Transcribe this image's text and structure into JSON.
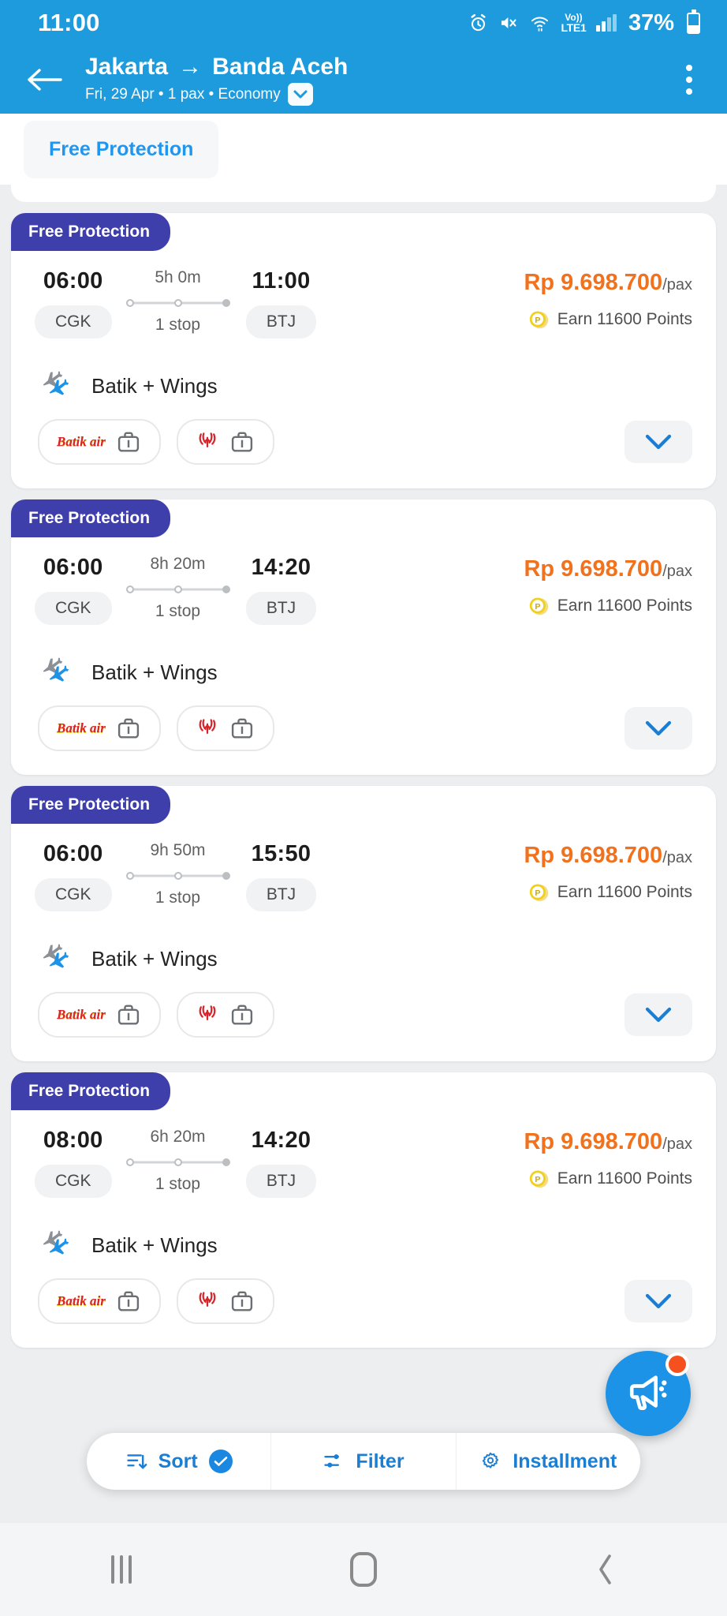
{
  "status_bar": {
    "time": "11:00",
    "battery_percent": "37%",
    "network_label_top": "Vo))",
    "network_label_bottom": "LTE1",
    "icons": [
      "alarm-icon",
      "mute-icon",
      "wifi-icon",
      "volte-icon",
      "signal-icon",
      "battery-icon"
    ]
  },
  "header": {
    "back_label": "back-arrow",
    "origin": "Jakarta",
    "arrow": "→",
    "destination": "Banda Aceh",
    "subtitle": "Fri, 29 Apr • 1 pax • Economy",
    "menu_label": "more-options"
  },
  "filter_strip": {
    "chips": [
      {
        "label": "Free Protection",
        "active": false
      }
    ]
  },
  "flights": [
    {
      "badge": "Free Protection",
      "depart_time": "06:00",
      "depart_airport": "CGK",
      "duration": "5h 0m",
      "stops": "1 stop",
      "arrive_time": "11:00",
      "arrive_airport": "BTJ",
      "price": "Rp 9.698.700",
      "price_unit": "/pax",
      "points": "Earn 11600 Points",
      "airline": "Batik + Wings",
      "bags": [
        {
          "logo": "Batik air",
          "type": "batik",
          "icon": "baggage-icon"
        },
        {
          "logo": "wings-air-logo",
          "type": "wings",
          "icon": "baggage-icon"
        }
      ]
    },
    {
      "badge": "Free Protection",
      "depart_time": "06:00",
      "depart_airport": "CGK",
      "duration": "8h 20m",
      "stops": "1 stop",
      "arrive_time": "14:20",
      "arrive_airport": "BTJ",
      "price": "Rp 9.698.700",
      "price_unit": "/pax",
      "points": "Earn 11600 Points",
      "airline": "Batik + Wings",
      "bags": [
        {
          "logo": "Batik air",
          "type": "batik",
          "icon": "baggage-icon"
        },
        {
          "logo": "wings-air-logo",
          "type": "wings",
          "icon": "baggage-icon"
        }
      ]
    },
    {
      "badge": "Free Protection",
      "depart_time": "06:00",
      "depart_airport": "CGK",
      "duration": "9h 50m",
      "stops": "1 stop",
      "arrive_time": "15:50",
      "arrive_airport": "BTJ",
      "price": "Rp 9.698.700",
      "price_unit": "/pax",
      "points": "Earn 11600 Points",
      "airline": "Batik + Wings",
      "bags": [
        {
          "logo": "Batik air",
          "type": "batik",
          "icon": "baggage-icon"
        },
        {
          "logo": "wings-air-logo",
          "type": "wings",
          "icon": "baggage-icon"
        }
      ]
    },
    {
      "badge": "Free Protection",
      "depart_time": "08:00",
      "depart_airport": "CGK",
      "duration": "6h 20m",
      "stops": "1 stop",
      "arrive_time": "14:20",
      "arrive_airport": "BTJ",
      "price": "Rp 9.698.700",
      "price_unit": "/pax",
      "points": "Earn 11600 Points",
      "airline": "Batik + Wings",
      "bags": [
        {
          "logo": "Batik air",
          "type": "batik",
          "icon": "baggage-icon"
        },
        {
          "logo": "wings-air-logo",
          "type": "wings",
          "icon": "baggage-icon"
        }
      ]
    }
  ],
  "fab": {
    "icon": "megaphone-icon",
    "has_notification_dot": true
  },
  "toolbar": {
    "sort_label": "Sort",
    "sort_active": true,
    "filter_label": "Filter",
    "installment_label": "Installment"
  },
  "nav_bar": {
    "recents": "recents-button",
    "home": "home-button",
    "back": "back-button"
  },
  "colors": {
    "header_blue": "#1d9bdc",
    "badge_indigo": "#3f3fab",
    "price_orange": "#f2711c",
    "link_blue": "#2196ee",
    "fab_blue": "#1d93e8",
    "fab_dot_orange": "#f4511e",
    "page_bg": "#eceef0"
  }
}
